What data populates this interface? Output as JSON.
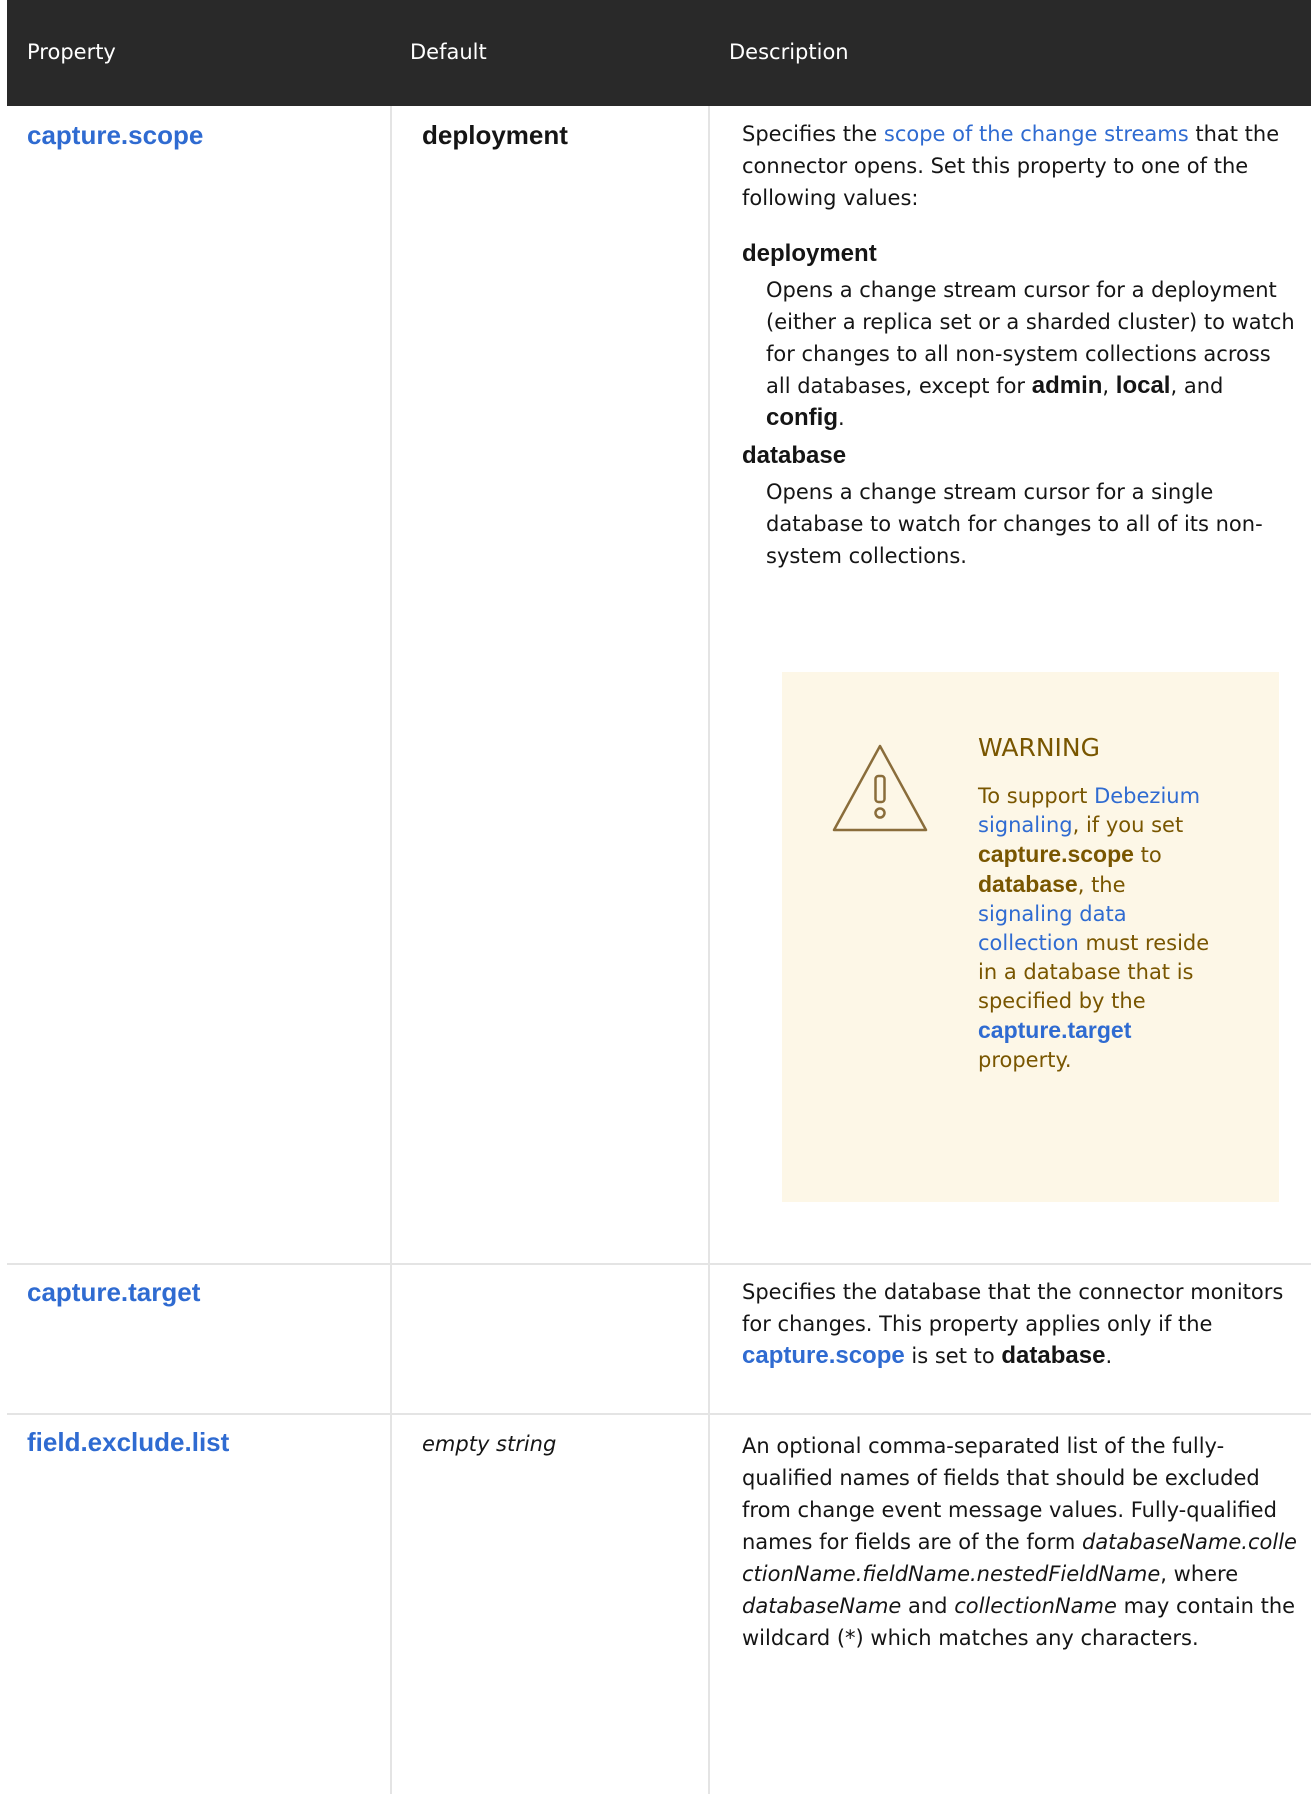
{
  "header": {
    "property": "Property",
    "default": "Default",
    "description": "Description"
  },
  "rows": [
    {
      "property": "capture.scope",
      "default": "deployment",
      "description": {
        "p1_pre": "Specifies the ",
        "p1_link": "scope of the change streams",
        "p1_post": " that the connector opens. Set this property to one of the following values:",
        "items": [
          {
            "term": "deployment",
            "def_pre": "Opens a change stream cursor for a deployment (either a replica set or a sharded cluster) to watch for changes to all non-system collections across all databases, except for ",
            "code1": "admin",
            "sep1": ", ",
            "code2": "local",
            "sep2": ", and ",
            "code3": "config",
            "def_end": "."
          },
          {
            "term": "database",
            "def": "Opens a change stream cursor for a single database to watch for changes to all of its non-system collections."
          }
        ],
        "warning": {
          "title": "WARNING",
          "t1": "To support ",
          "link1": "Debezium signaling",
          "t2": ", if you set ",
          "code1": "capture.scope",
          "t3": " to ",
          "code2": "database",
          "t4": ", the ",
          "link2": "signaling data collection",
          "t5": " must reside in a database that is specified by the ",
          "code3": "capture.target",
          "t6": " property."
        }
      }
    },
    {
      "property": "capture.target",
      "default": "",
      "description": {
        "pre": "Specifies the database that the connector monitors for changes. This property applies only if the ",
        "code1": "capture.scope",
        "mid": " is set to ",
        "code2": "database",
        "end": "."
      }
    },
    {
      "property": "field.exclude.list",
      "default": "empty string",
      "description": {
        "pre": "An optional comma-separated list of the fully-qualified names of fields that should be excluded from change event message values. Fully-qualified names for fields are of the form ",
        "form": "databaseName.collectionName.fieldName.nestedFieldName",
        "mid1": ", where ",
        "var1": "databaseName",
        "mid2": " and ",
        "var2": "collectionName",
        "end": " may contain the wildcard (*) which matches any characters."
      }
    }
  ],
  "colors": {
    "header_bg": "#292929",
    "link": "#2f6bd1",
    "warning_bg": "#fdf7e7",
    "warning_text": "#795600"
  },
  "icons": [
    "warning-triangle-icon"
  ]
}
